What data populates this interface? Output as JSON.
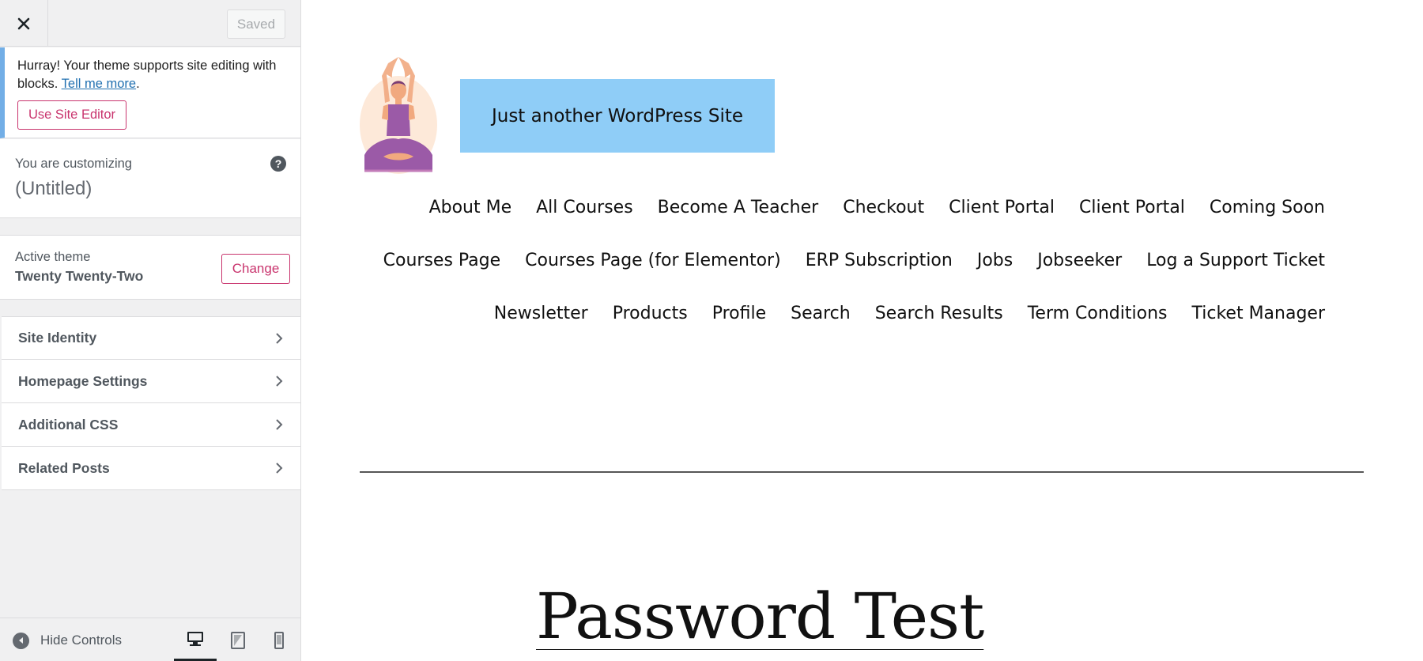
{
  "sidebar": {
    "saved_label": "Saved",
    "notice": {
      "text": "Hurray! Your theme supports site editing with blocks. ",
      "link": "Tell me more",
      "period": ".",
      "button": "Use Site Editor"
    },
    "customizing": {
      "label": "You are customizing",
      "title": "(Untitled)"
    },
    "theme": {
      "label": "Active theme",
      "name": "Twenty Twenty-Two",
      "change": "Change"
    },
    "sections": [
      {
        "label": "Site Identity"
      },
      {
        "label": "Homepage Settings"
      },
      {
        "label": "Additional CSS"
      },
      {
        "label": "Related Posts"
      }
    ],
    "footer": {
      "hide_label": "Hide Controls",
      "active_device": "desktop"
    }
  },
  "preview": {
    "tagline": "Just another WordPress Site",
    "tagline_bg": "#8fcdf7",
    "nav_rows": [
      [
        "About Me",
        "All Courses",
        "Become A Teacher",
        "Checkout",
        "Client Portal",
        "Client Portal",
        "Coming Soon"
      ],
      [
        "Courses Page",
        "Courses Page (for Elementor)",
        "ERP Subscription",
        "Jobs",
        "Jobseeker",
        "Log a Support Ticket"
      ],
      [
        "Newsletter",
        "Products",
        "Profile",
        "Search",
        "Search Results",
        "Term Conditions",
        "Ticket Manager"
      ]
    ],
    "post_title": "Password Test"
  },
  "colors": {
    "accent": "#c9356e",
    "link": "#2271b1",
    "notice_border": "#72aee6"
  }
}
